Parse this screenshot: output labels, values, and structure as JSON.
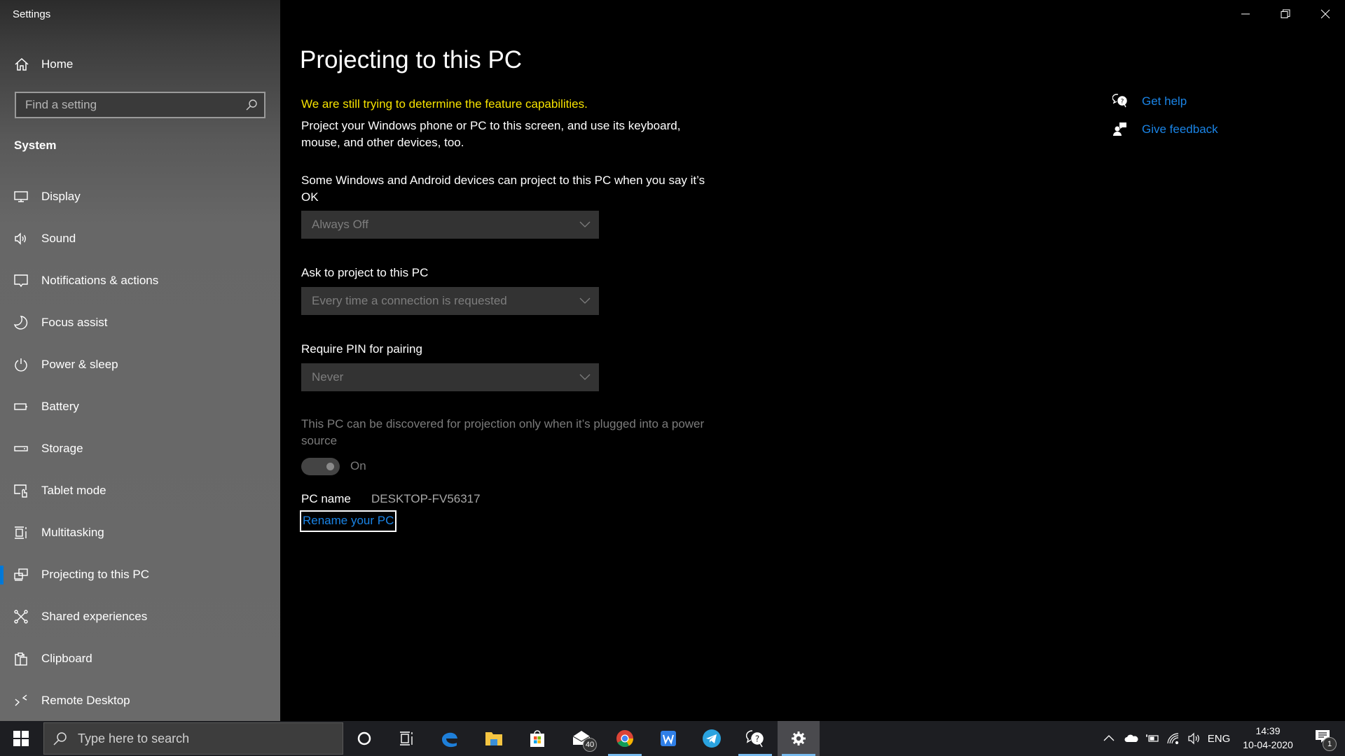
{
  "window": {
    "app_title": "Settings",
    "controls": {
      "minimize": "minimize",
      "restore": "restore",
      "close": "close"
    }
  },
  "sidebar": {
    "home_label": "Home",
    "search_placeholder": "Find a setting",
    "section_label": "System",
    "items": [
      {
        "label": "Display",
        "icon": "display-icon"
      },
      {
        "label": "Sound",
        "icon": "sound-icon"
      },
      {
        "label": "Notifications & actions",
        "icon": "notifications-icon"
      },
      {
        "label": "Focus assist",
        "icon": "moon-icon"
      },
      {
        "label": "Power & sleep",
        "icon": "power-icon"
      },
      {
        "label": "Battery",
        "icon": "battery-icon"
      },
      {
        "label": "Storage",
        "icon": "storage-icon"
      },
      {
        "label": "Tablet mode",
        "icon": "tablet-mode-icon"
      },
      {
        "label": "Multitasking",
        "icon": "multitasking-icon"
      },
      {
        "label": "Projecting to this PC",
        "icon": "projecting-icon",
        "active": true
      },
      {
        "label": "Shared experiences",
        "icon": "shared-experiences-icon"
      },
      {
        "label": "Clipboard",
        "icon": "clipboard-icon"
      },
      {
        "label": "Remote Desktop",
        "icon": "remote-desktop-icon"
      }
    ],
    "accent_color": "#0078d7"
  },
  "main": {
    "title": "Projecting to this PC",
    "warning": "We are still trying to determine the feature capabilities.",
    "warning_color": "#f7e300",
    "description": "Project your Windows phone or PC to this screen, and use its keyboard, mouse, and other devices, too.",
    "settings": [
      {
        "label": "Some Windows and Android devices can project to this PC when you say it’s OK",
        "value": "Always Off"
      },
      {
        "label": "Ask to project to this PC",
        "value": "Every time a connection is requested"
      },
      {
        "label": "Require PIN for pairing",
        "value": "Never"
      }
    ],
    "power_note": "This PC can be discovered for projection only when it’s plugged into a power source",
    "power_toggle": {
      "state": "On",
      "on": true
    },
    "pc_name_label": "PC name",
    "pc_name_value": "DESKTOP-FV56317",
    "rename_link": "Rename your PC",
    "link_color": "#1a84e6"
  },
  "aside": {
    "get_help": "Get help",
    "give_feedback": "Give feedback"
  },
  "taskbar": {
    "search_placeholder": "Type here to search",
    "apps": [
      {
        "name": "cortana",
        "icon": "cortana-icon"
      },
      {
        "name": "task-view",
        "icon": "task-view-icon"
      },
      {
        "name": "edge",
        "icon": "edge-icon"
      },
      {
        "name": "file-explorer",
        "icon": "folder-icon"
      },
      {
        "name": "store",
        "icon": "store-icon"
      },
      {
        "name": "mail",
        "icon": "mail-icon",
        "badge": "40"
      },
      {
        "name": "chrome",
        "icon": "chrome-icon",
        "running": true
      },
      {
        "name": "wps-office",
        "icon": "wps-icon"
      },
      {
        "name": "telegram",
        "icon": "telegram-icon"
      },
      {
        "name": "get-help",
        "icon": "get-help-icon",
        "running": true
      },
      {
        "name": "settings",
        "icon": "gear-icon",
        "running": true,
        "active": true
      }
    ],
    "tray": {
      "language": "ENG",
      "time": "14:39",
      "date": "10-04-2020",
      "notification_count": "1"
    }
  }
}
